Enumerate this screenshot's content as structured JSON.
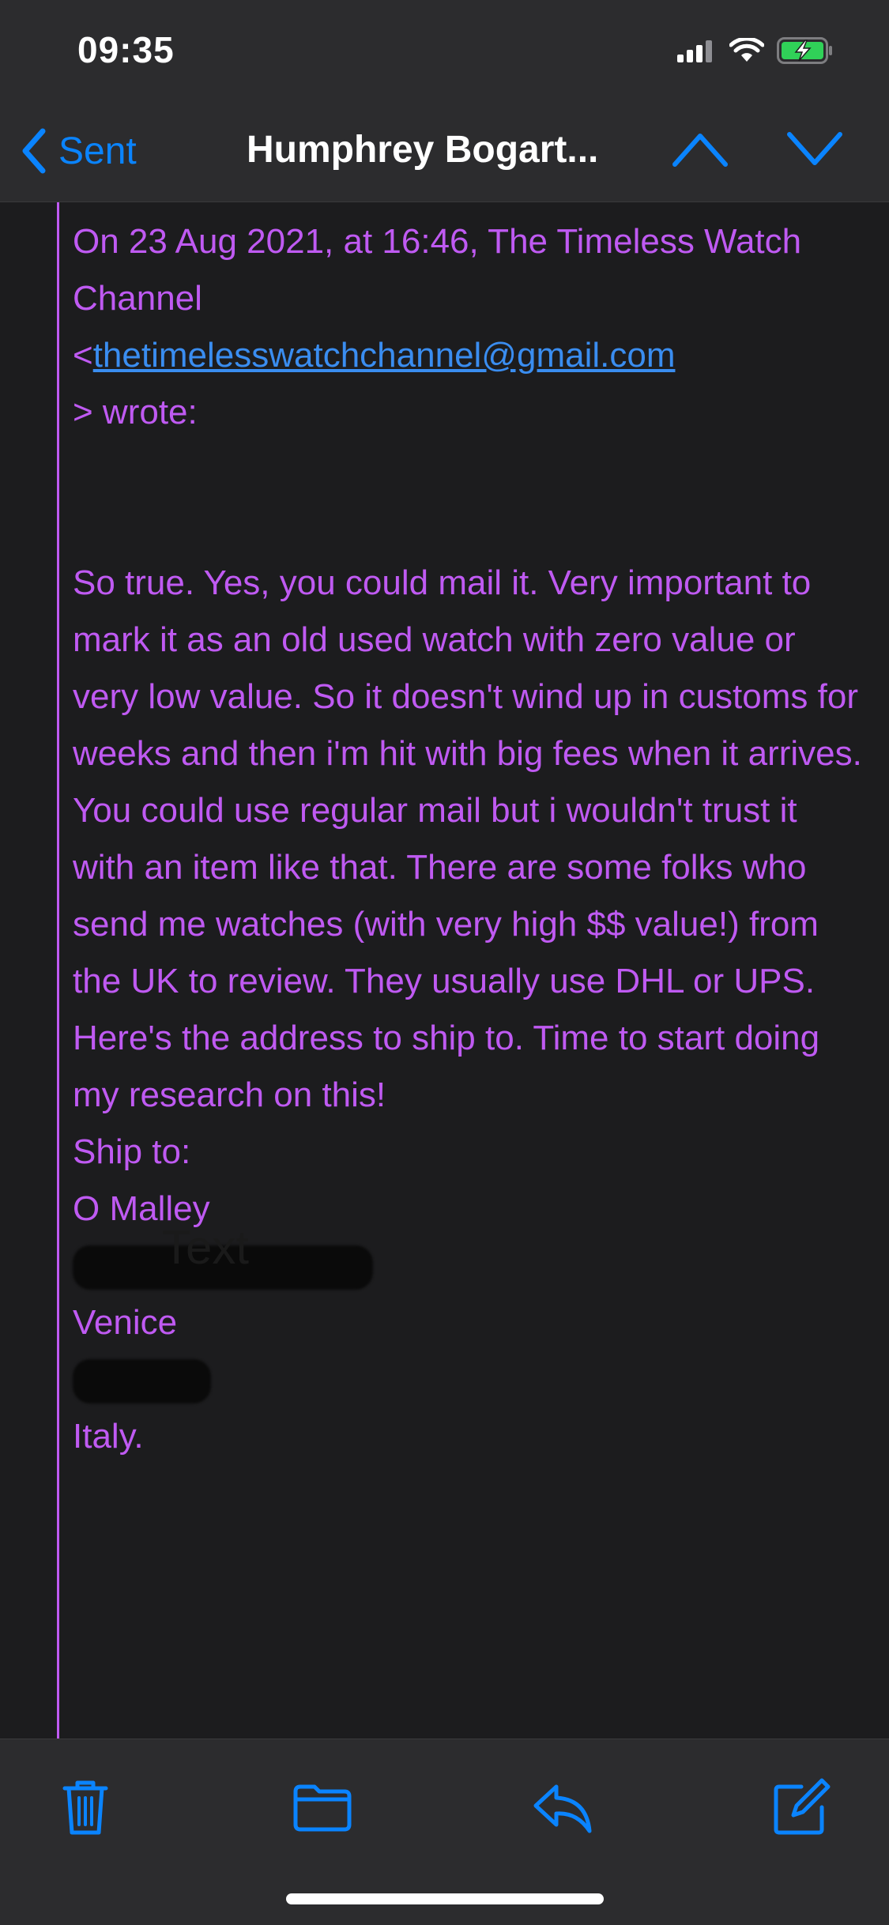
{
  "status_bar": {
    "time": "09:35"
  },
  "nav": {
    "back_label": "Sent",
    "title": "Humphrey Bogart...",
    "icons": [
      "chevron-left-icon",
      "chevron-up-icon",
      "chevron-down-icon"
    ]
  },
  "email": {
    "header_line_1": "On 23 Aug 2021, at 16:46, The Timeless Watch Channel",
    "header_open_bracket": "<",
    "header_email": "thetimelesswatchchannel@gmail.com",
    "header_line_3": "> wrote:",
    "paragraph_1": "So true. Yes, you could mail it. Very important to mark it as an old used watch with zero value or very low value. So it doesn't wind up in customs for weeks and then i'm hit with big fees when it arrives.",
    "paragraph_2": "You could use regular mail but i wouldn't trust it with an item like that. There are some folks who send me watches (with very high $$ value!) from the UK to review. They usually use DHL or UPS. Here's the address to ship to. Time to start doing my research on this!",
    "ship_to_label": "Ship to:",
    "ship_name": "O Malley",
    "ship_city": "Venice",
    "ship_country": "Italy.",
    "stray_overlay": "Text"
  },
  "toolbar": {
    "icons": [
      "trash-icon",
      "folder-icon",
      "reply-icon",
      "compose-icon"
    ]
  },
  "colors": {
    "quote_text": "#bf5af2",
    "accent": "#0a84ff",
    "link": "#3a8df0",
    "background": "#1c1c1e",
    "bars": "#2c2c2e"
  }
}
